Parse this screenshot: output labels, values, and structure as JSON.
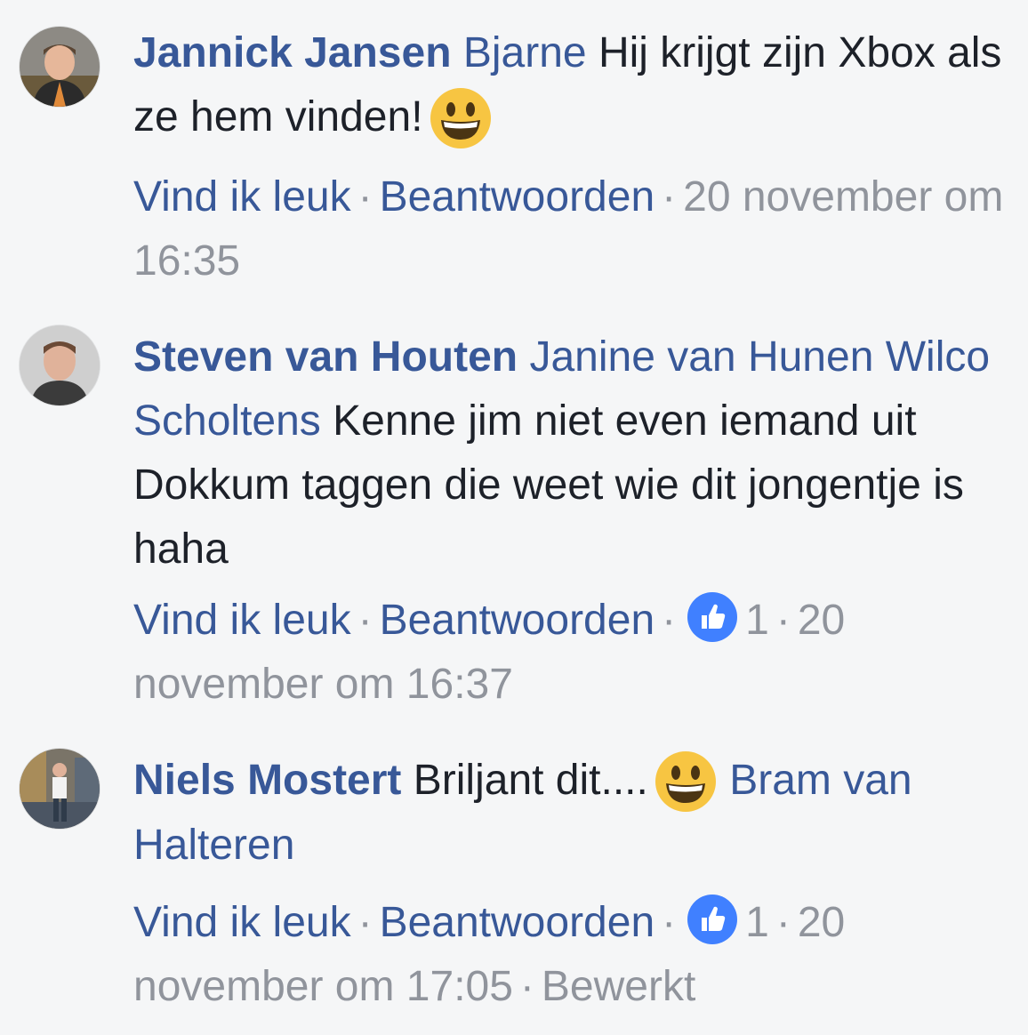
{
  "comments": [
    {
      "author": "Jannick Jansen",
      "tags": [
        "Bjarne"
      ],
      "text": "Hij krijgt zijn Xbox als ze hem vinden!",
      "emoji": "grinning-face-emoji",
      "like_label": "Vind ik leuk",
      "reply_label": "Beantwoorden",
      "reaction_count": "",
      "timestamp": "20 november om 16:35",
      "edited": ""
    },
    {
      "author": "Steven van Houten",
      "tags": [
        "Janine van Hunen",
        "Wilco Scholtens"
      ],
      "text": "Kenne jim niet even iemand uit Dokkum taggen die weet wie dit jongentje is haha",
      "emoji": "",
      "like_label": "Vind ik leuk",
      "reply_label": "Beantwoorden",
      "reaction_count": "1",
      "timestamp": "20 november om 16:37",
      "edited": ""
    },
    {
      "author": "Niels Mostert",
      "tags": [
        "Bram van Halteren"
      ],
      "text": "Briljant dit....",
      "emoji": "grinning-face-emoji",
      "like_label": "Vind ik leuk",
      "reply_label": "Beantwoorden",
      "reaction_count": "1",
      "timestamp": "20 november om 17:05",
      "edited": "Bewerkt"
    }
  ],
  "colors": {
    "link": "#385898",
    "meta": "#90949c",
    "text": "#1d2129",
    "background": "#f5f6f7",
    "like_badge": "#4080ff"
  }
}
